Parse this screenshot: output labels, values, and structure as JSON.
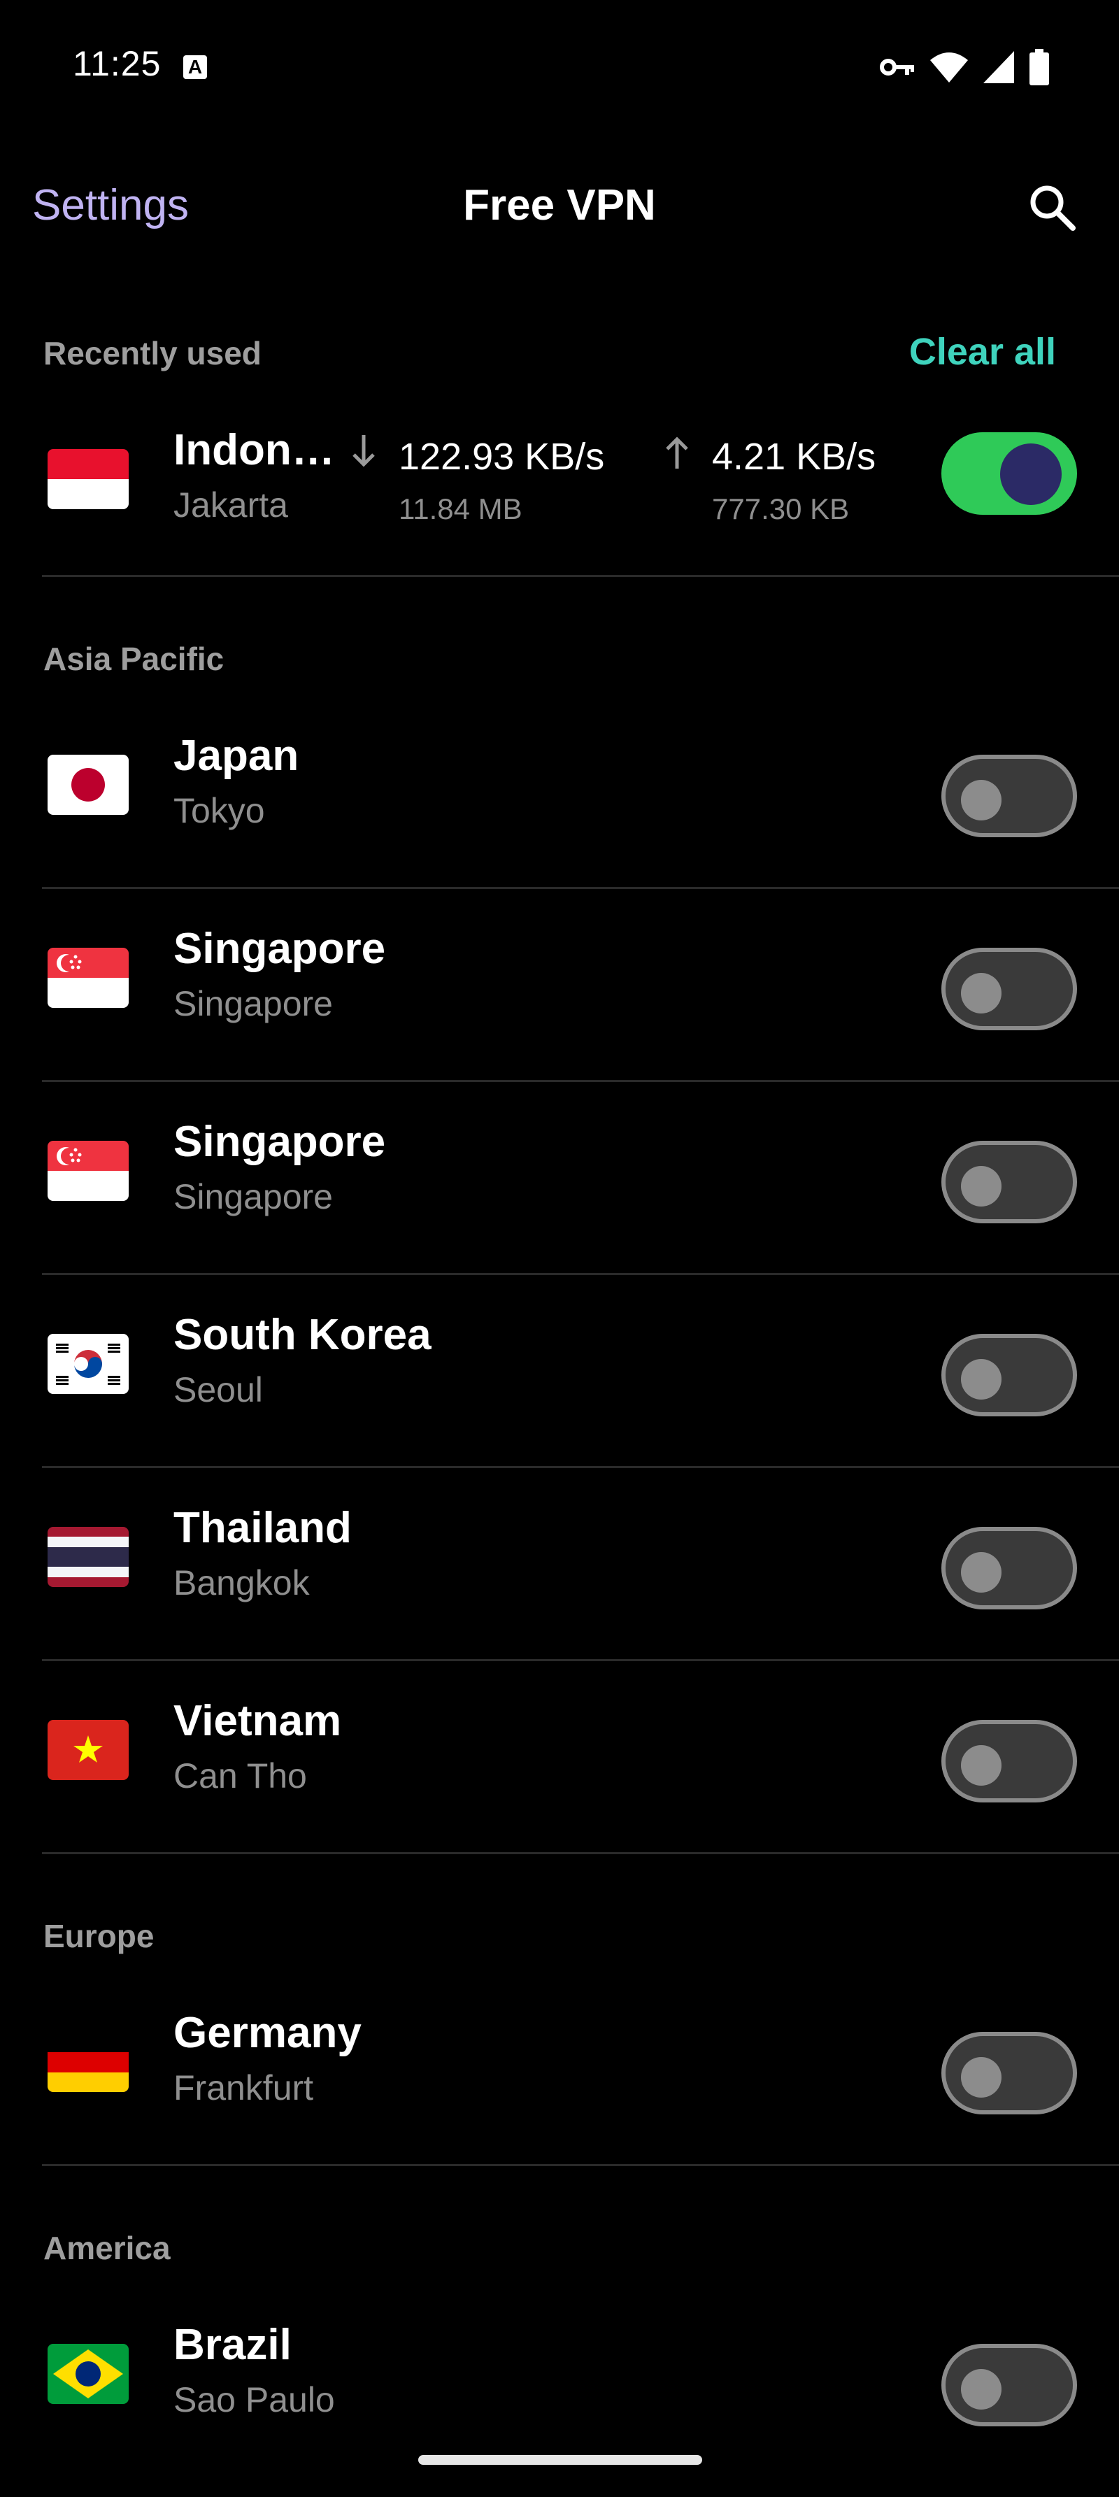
{
  "status": {
    "time": "11:25",
    "notification_badge": "A"
  },
  "header": {
    "back_label": "Settings",
    "title": "Free VPN",
    "search_icon": "search-icon"
  },
  "recent": {
    "title": "Recently used",
    "clear_all": "Clear all",
    "item": {
      "country": "Indon…",
      "city": "Jakarta",
      "download_rate": "122.93 KB/s",
      "download_total": "11.84 MB",
      "upload_rate": "4.21 KB/s",
      "upload_total": "777.30 KB",
      "connected": true
    }
  },
  "sections": [
    {
      "title": "Asia Pacific",
      "items": [
        {
          "country": "Japan",
          "city": "Tokyo"
        },
        {
          "country": "Singapore",
          "city": "Singapore"
        },
        {
          "country": "Singapore",
          "city": "Singapore"
        },
        {
          "country": "South Korea",
          "city": "Seoul"
        },
        {
          "country": "Thailand",
          "city": "Bangkok"
        },
        {
          "country": "Vietnam",
          "city": "Can Tho"
        }
      ]
    },
    {
      "title": "Europe",
      "items": [
        {
          "country": "Germany",
          "city": "Frankfurt"
        }
      ]
    },
    {
      "title": "America",
      "items": [
        {
          "country": "Brazil",
          "city": "Sao Paulo"
        }
      ]
    }
  ],
  "colors": {
    "accent_link": "#c0b3f2",
    "clear_all": "#3fd3bd",
    "toggle_on": "#2fca58",
    "knob_on": "#2b2a66"
  }
}
